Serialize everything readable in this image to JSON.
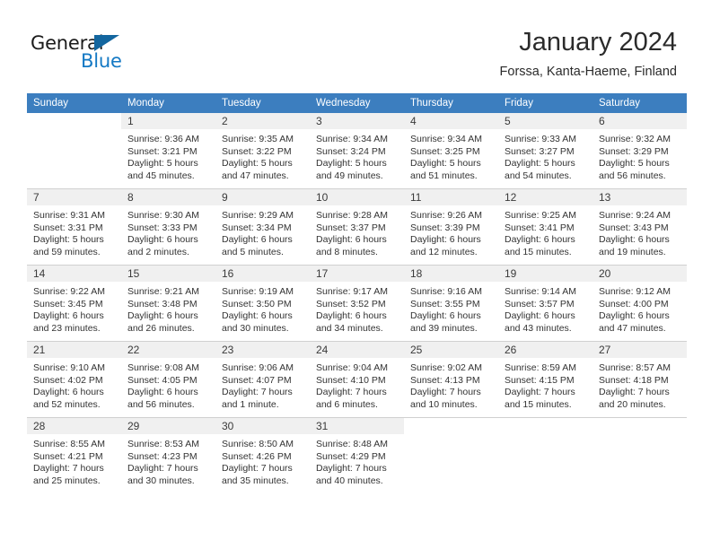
{
  "brand": {
    "name_top": "General",
    "name_bottom": "Blue",
    "triangle_color": "#13669f",
    "blue_color": "#1479c4"
  },
  "header": {
    "title": "January 2024",
    "subtitle": "Forssa, Kanta-Haeme, Finland"
  },
  "theme": {
    "header_bar": "#3c7ebf",
    "daynum_bg": "#f0f0f0",
    "grid_line": "#d0d0d0",
    "text": "#333333"
  },
  "weekday_headers": [
    "Sunday",
    "Monday",
    "Tuesday",
    "Wednesday",
    "Thursday",
    "Friday",
    "Saturday"
  ],
  "weeks": [
    [
      {
        "day": "",
        "empty": true,
        "sunrise": "",
        "sunset": "",
        "daylight_line1": "",
        "daylight_line2": ""
      },
      {
        "day": "1",
        "empty": false,
        "sunrise": "Sunrise: 9:36 AM",
        "sunset": "Sunset: 3:21 PM",
        "daylight_line1": "Daylight: 5 hours",
        "daylight_line2": "and 45 minutes."
      },
      {
        "day": "2",
        "empty": false,
        "sunrise": "Sunrise: 9:35 AM",
        "sunset": "Sunset: 3:22 PM",
        "daylight_line1": "Daylight: 5 hours",
        "daylight_line2": "and 47 minutes."
      },
      {
        "day": "3",
        "empty": false,
        "sunrise": "Sunrise: 9:34 AM",
        "sunset": "Sunset: 3:24 PM",
        "daylight_line1": "Daylight: 5 hours",
        "daylight_line2": "and 49 minutes."
      },
      {
        "day": "4",
        "empty": false,
        "sunrise": "Sunrise: 9:34 AM",
        "sunset": "Sunset: 3:25 PM",
        "daylight_line1": "Daylight: 5 hours",
        "daylight_line2": "and 51 minutes."
      },
      {
        "day": "5",
        "empty": false,
        "sunrise": "Sunrise: 9:33 AM",
        "sunset": "Sunset: 3:27 PM",
        "daylight_line1": "Daylight: 5 hours",
        "daylight_line2": "and 54 minutes."
      },
      {
        "day": "6",
        "empty": false,
        "sunrise": "Sunrise: 9:32 AM",
        "sunset": "Sunset: 3:29 PM",
        "daylight_line1": "Daylight: 5 hours",
        "daylight_line2": "and 56 minutes."
      }
    ],
    [
      {
        "day": "7",
        "empty": false,
        "sunrise": "Sunrise: 9:31 AM",
        "sunset": "Sunset: 3:31 PM",
        "daylight_line1": "Daylight: 5 hours",
        "daylight_line2": "and 59 minutes."
      },
      {
        "day": "8",
        "empty": false,
        "sunrise": "Sunrise: 9:30 AM",
        "sunset": "Sunset: 3:33 PM",
        "daylight_line1": "Daylight: 6 hours",
        "daylight_line2": "and 2 minutes."
      },
      {
        "day": "9",
        "empty": false,
        "sunrise": "Sunrise: 9:29 AM",
        "sunset": "Sunset: 3:34 PM",
        "daylight_line1": "Daylight: 6 hours",
        "daylight_line2": "and 5 minutes."
      },
      {
        "day": "10",
        "empty": false,
        "sunrise": "Sunrise: 9:28 AM",
        "sunset": "Sunset: 3:37 PM",
        "daylight_line1": "Daylight: 6 hours",
        "daylight_line2": "and 8 minutes."
      },
      {
        "day": "11",
        "empty": false,
        "sunrise": "Sunrise: 9:26 AM",
        "sunset": "Sunset: 3:39 PM",
        "daylight_line1": "Daylight: 6 hours",
        "daylight_line2": "and 12 minutes."
      },
      {
        "day": "12",
        "empty": false,
        "sunrise": "Sunrise: 9:25 AM",
        "sunset": "Sunset: 3:41 PM",
        "daylight_line1": "Daylight: 6 hours",
        "daylight_line2": "and 15 minutes."
      },
      {
        "day": "13",
        "empty": false,
        "sunrise": "Sunrise: 9:24 AM",
        "sunset": "Sunset: 3:43 PM",
        "daylight_line1": "Daylight: 6 hours",
        "daylight_line2": "and 19 minutes."
      }
    ],
    [
      {
        "day": "14",
        "empty": false,
        "sunrise": "Sunrise: 9:22 AM",
        "sunset": "Sunset: 3:45 PM",
        "daylight_line1": "Daylight: 6 hours",
        "daylight_line2": "and 23 minutes."
      },
      {
        "day": "15",
        "empty": false,
        "sunrise": "Sunrise: 9:21 AM",
        "sunset": "Sunset: 3:48 PM",
        "daylight_line1": "Daylight: 6 hours",
        "daylight_line2": "and 26 minutes."
      },
      {
        "day": "16",
        "empty": false,
        "sunrise": "Sunrise: 9:19 AM",
        "sunset": "Sunset: 3:50 PM",
        "daylight_line1": "Daylight: 6 hours",
        "daylight_line2": "and 30 minutes."
      },
      {
        "day": "17",
        "empty": false,
        "sunrise": "Sunrise: 9:17 AM",
        "sunset": "Sunset: 3:52 PM",
        "daylight_line1": "Daylight: 6 hours",
        "daylight_line2": "and 34 minutes."
      },
      {
        "day": "18",
        "empty": false,
        "sunrise": "Sunrise: 9:16 AM",
        "sunset": "Sunset: 3:55 PM",
        "daylight_line1": "Daylight: 6 hours",
        "daylight_line2": "and 39 minutes."
      },
      {
        "day": "19",
        "empty": false,
        "sunrise": "Sunrise: 9:14 AM",
        "sunset": "Sunset: 3:57 PM",
        "daylight_line1": "Daylight: 6 hours",
        "daylight_line2": "and 43 minutes."
      },
      {
        "day": "20",
        "empty": false,
        "sunrise": "Sunrise: 9:12 AM",
        "sunset": "Sunset: 4:00 PM",
        "daylight_line1": "Daylight: 6 hours",
        "daylight_line2": "and 47 minutes."
      }
    ],
    [
      {
        "day": "21",
        "empty": false,
        "sunrise": "Sunrise: 9:10 AM",
        "sunset": "Sunset: 4:02 PM",
        "daylight_line1": "Daylight: 6 hours",
        "daylight_line2": "and 52 minutes."
      },
      {
        "day": "22",
        "empty": false,
        "sunrise": "Sunrise: 9:08 AM",
        "sunset": "Sunset: 4:05 PM",
        "daylight_line1": "Daylight: 6 hours",
        "daylight_line2": "and 56 minutes."
      },
      {
        "day": "23",
        "empty": false,
        "sunrise": "Sunrise: 9:06 AM",
        "sunset": "Sunset: 4:07 PM",
        "daylight_line1": "Daylight: 7 hours",
        "daylight_line2": "and 1 minute."
      },
      {
        "day": "24",
        "empty": false,
        "sunrise": "Sunrise: 9:04 AM",
        "sunset": "Sunset: 4:10 PM",
        "daylight_line1": "Daylight: 7 hours",
        "daylight_line2": "and 6 minutes."
      },
      {
        "day": "25",
        "empty": false,
        "sunrise": "Sunrise: 9:02 AM",
        "sunset": "Sunset: 4:13 PM",
        "daylight_line1": "Daylight: 7 hours",
        "daylight_line2": "and 10 minutes."
      },
      {
        "day": "26",
        "empty": false,
        "sunrise": "Sunrise: 8:59 AM",
        "sunset": "Sunset: 4:15 PM",
        "daylight_line1": "Daylight: 7 hours",
        "daylight_line2": "and 15 minutes."
      },
      {
        "day": "27",
        "empty": false,
        "sunrise": "Sunrise: 8:57 AM",
        "sunset": "Sunset: 4:18 PM",
        "daylight_line1": "Daylight: 7 hours",
        "daylight_line2": "and 20 minutes."
      }
    ],
    [
      {
        "day": "28",
        "empty": false,
        "sunrise": "Sunrise: 8:55 AM",
        "sunset": "Sunset: 4:21 PM",
        "daylight_line1": "Daylight: 7 hours",
        "daylight_line2": "and 25 minutes."
      },
      {
        "day": "29",
        "empty": false,
        "sunrise": "Sunrise: 8:53 AM",
        "sunset": "Sunset: 4:23 PM",
        "daylight_line1": "Daylight: 7 hours",
        "daylight_line2": "and 30 minutes."
      },
      {
        "day": "30",
        "empty": false,
        "sunrise": "Sunrise: 8:50 AM",
        "sunset": "Sunset: 4:26 PM",
        "daylight_line1": "Daylight: 7 hours",
        "daylight_line2": "and 35 minutes."
      },
      {
        "day": "31",
        "empty": false,
        "sunrise": "Sunrise: 8:48 AM",
        "sunset": "Sunset: 4:29 PM",
        "daylight_line1": "Daylight: 7 hours",
        "daylight_line2": "and 40 minutes."
      },
      {
        "day": "",
        "empty": true,
        "sunrise": "",
        "sunset": "",
        "daylight_line1": "",
        "daylight_line2": ""
      },
      {
        "day": "",
        "empty": true,
        "sunrise": "",
        "sunset": "",
        "daylight_line1": "",
        "daylight_line2": ""
      },
      {
        "day": "",
        "empty": true,
        "sunrise": "",
        "sunset": "",
        "daylight_line1": "",
        "daylight_line2": ""
      }
    ]
  ]
}
